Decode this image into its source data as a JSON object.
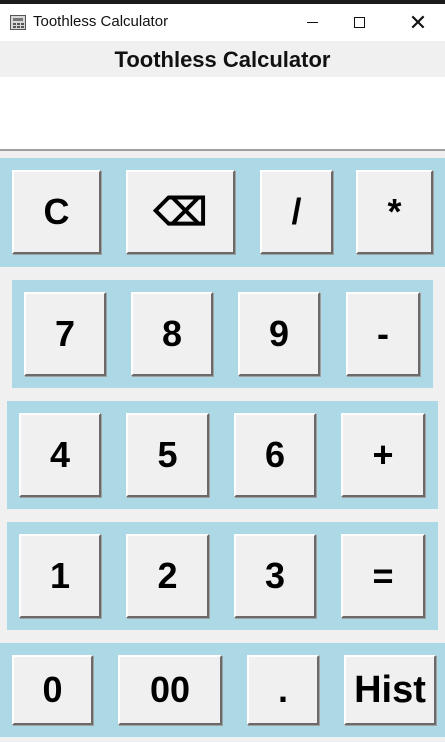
{
  "window": {
    "title": "Toothless Calculator",
    "controls": {
      "minimize": "minimize",
      "maximize": "maximize",
      "close": "close"
    }
  },
  "app": {
    "heading": "Toothless Calculator"
  },
  "display": {
    "value": ""
  },
  "colors": {
    "row_background": "#add8e6",
    "button_face": "#f0f0f0",
    "window_background": "#f0f0f0"
  },
  "keypad": {
    "row1": [
      "C",
      "⌫",
      "/",
      "*"
    ],
    "row2": [
      "7",
      "8",
      "9",
      "-"
    ],
    "row3": [
      "4",
      "5",
      "6",
      "+"
    ],
    "row4": [
      "1",
      "2",
      "3",
      "="
    ],
    "row5": [
      "0",
      "00",
      ".",
      "Hist"
    ]
  }
}
